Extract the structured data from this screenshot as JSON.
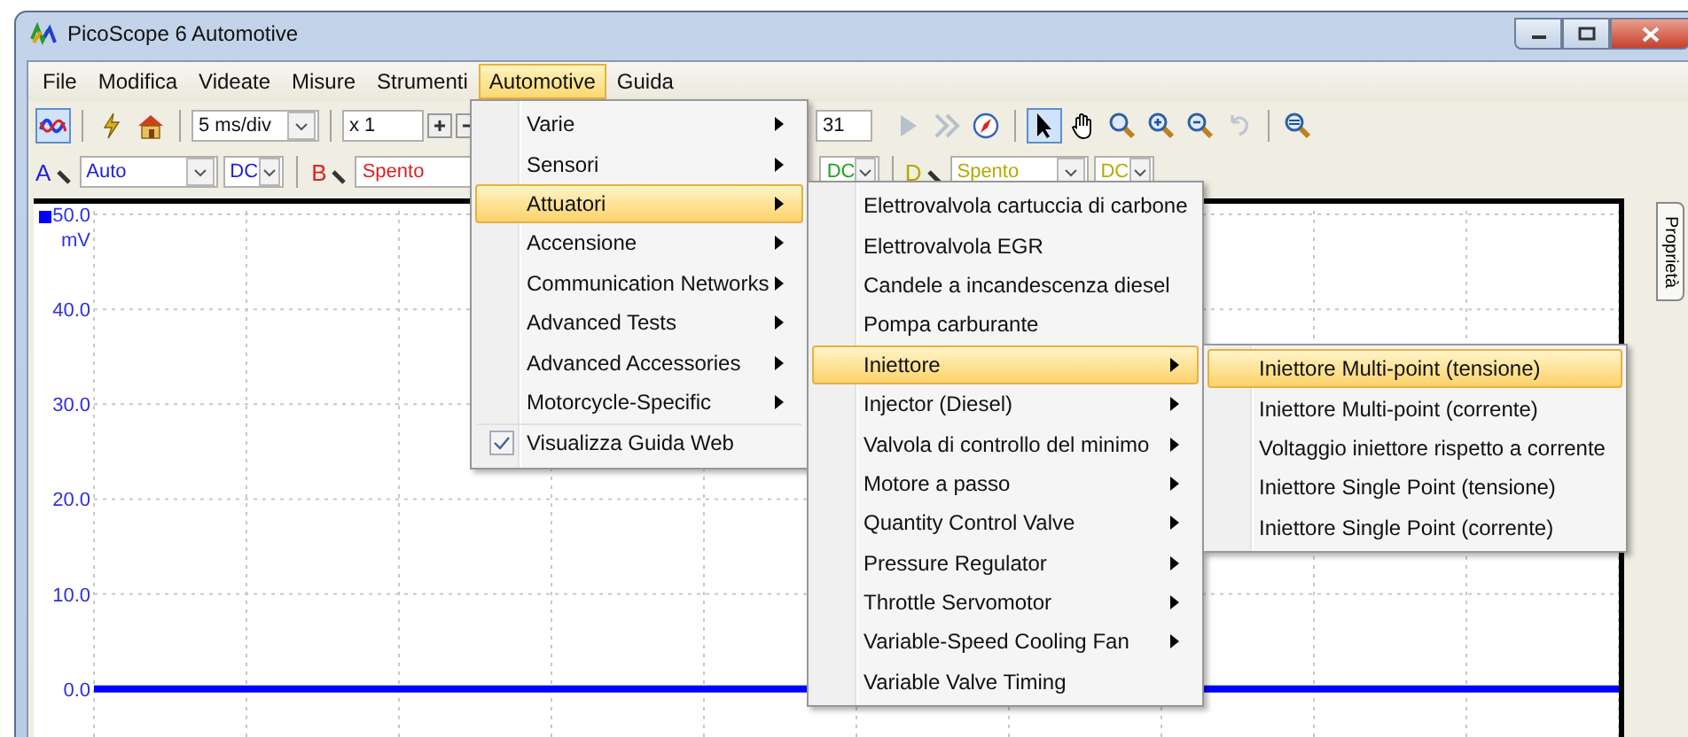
{
  "window": {
    "title": "PicoScope 6 Automotive"
  },
  "menubar": [
    {
      "label": "File",
      "selected": false
    },
    {
      "label": "Modifica",
      "selected": false
    },
    {
      "label": "Videate",
      "selected": false
    },
    {
      "label": "Misure",
      "selected": false
    },
    {
      "label": "Strumenti",
      "selected": false
    },
    {
      "label": "Automotive",
      "selected": true
    },
    {
      "label": "Guida",
      "selected": false
    }
  ],
  "timebase": {
    "value": "5 ms/div"
  },
  "multiplier": {
    "value": "x 1"
  },
  "capture_count": {
    "value": "31"
  },
  "tools": [
    {
      "kind": "play",
      "selected": false,
      "disabled": true
    },
    {
      "kind": "stop",
      "selected": false,
      "disabled": true
    },
    {
      "kind": "compass",
      "selected": false,
      "disabled": false
    },
    {
      "kind": "pointer",
      "selected": true,
      "disabled": false
    },
    {
      "kind": "hand",
      "selected": false,
      "disabled": false
    },
    {
      "kind": "zoom",
      "selected": false,
      "disabled": false
    },
    {
      "kind": "zoom_in",
      "selected": false,
      "disabled": false
    },
    {
      "kind": "zoom_out",
      "selected": false,
      "disabled": false
    },
    {
      "kind": "undo",
      "selected": false,
      "disabled": true
    },
    {
      "kind": "zoom_full",
      "selected": false,
      "disabled": false
    }
  ],
  "channels": [
    {
      "letter": "A",
      "color": "#2020e0",
      "range": "Auto",
      "coupling": "DC"
    },
    {
      "letter": "B",
      "color": "#e02020",
      "range": "Spento"
    },
    {
      "color": "#20a020",
      "coupling": "DC"
    },
    {
      "letter": "D",
      "color": "#b8a800",
      "range": "Spento",
      "coupling": "DC"
    }
  ],
  "scope": {
    "side_tab": "Proprietà",
    "chart_data": {
      "type": "line",
      "ylabel": "mV",
      "ylim": [
        -6,
        50
      ],
      "grid": true,
      "yticks": [
        {
          "value": 50,
          "label": "50.0"
        },
        {
          "value": 40,
          "label": "40.0"
        },
        {
          "value": 30,
          "label": "30.0"
        },
        {
          "value": 20,
          "label": "20.0"
        },
        {
          "value": 10,
          "label": "10.0"
        },
        {
          "value": 0,
          "label": "0.0"
        }
      ],
      "series": [
        {
          "color": "#0000ff",
          "values": [
            0,
            0,
            0,
            0,
            0,
            null,
            null,
            null,
            0,
            0,
            0
          ]
        }
      ]
    }
  },
  "automotive_menu": [
    {
      "label": "Varie",
      "kind": "submenu",
      "selected": false
    },
    {
      "label": "Sensori",
      "kind": "submenu",
      "selected": false
    },
    {
      "label": "Attuatori",
      "kind": "submenu",
      "selected": true
    },
    {
      "label": "Accensione",
      "kind": "submenu",
      "selected": false
    },
    {
      "label": "Communication Networks",
      "kind": "submenu",
      "selected": false
    },
    {
      "label": "Advanced Tests",
      "kind": "submenu",
      "selected": false
    },
    {
      "label": "Advanced Accessories",
      "kind": "submenu",
      "selected": false
    },
    {
      "label": "Motorcycle-Specific",
      "kind": "submenu",
      "selected": false
    },
    {
      "label": "Visualizza Guida Web",
      "kind": "check",
      "selected": false,
      "checked": true
    }
  ],
  "attuatori_menu": [
    {
      "label": "Elettrovalvola cartuccia di carbone",
      "kind": "item",
      "selected": false
    },
    {
      "label": "Elettrovalvola EGR",
      "kind": "item",
      "selected": false
    },
    {
      "label": "Candele a incandescenza diesel",
      "kind": "item",
      "selected": false
    },
    {
      "label": "Pompa carburante",
      "kind": "item",
      "selected": false
    },
    {
      "label": "Iniettore",
      "kind": "submenu",
      "selected": true
    },
    {
      "label": "Injector (Diesel)",
      "kind": "submenu",
      "selected": false
    },
    {
      "label": "Valvola di controllo del minimo",
      "kind": "submenu",
      "selected": false
    },
    {
      "label": "Motore a passo",
      "kind": "submenu",
      "selected": false
    },
    {
      "label": "Quantity Control Valve",
      "kind": "submenu",
      "selected": false
    },
    {
      "label": "Pressure Regulator",
      "kind": "submenu",
      "selected": false
    },
    {
      "label": "Throttle Servomotor",
      "kind": "submenu",
      "selected": false
    },
    {
      "label": "Variable-Speed Cooling Fan",
      "kind": "submenu",
      "selected": false
    },
    {
      "label": "Variable Valve Timing",
      "kind": "item",
      "selected": false
    }
  ],
  "iniettore_menu": [
    {
      "label": "Iniettore Multi-point (tensione)",
      "kind": "item",
      "selected": true
    },
    {
      "label": "Iniettore Multi-point (corrente)",
      "kind": "item",
      "selected": false
    },
    {
      "label": "Voltaggio iniettore rispetto a corrente",
      "kind": "item",
      "selected": false
    },
    {
      "label": "Iniettore Single Point (tensione)",
      "kind": "item",
      "selected": false
    },
    {
      "label": "Iniettore Single Point (corrente)",
      "kind": "item",
      "selected": false
    }
  ]
}
